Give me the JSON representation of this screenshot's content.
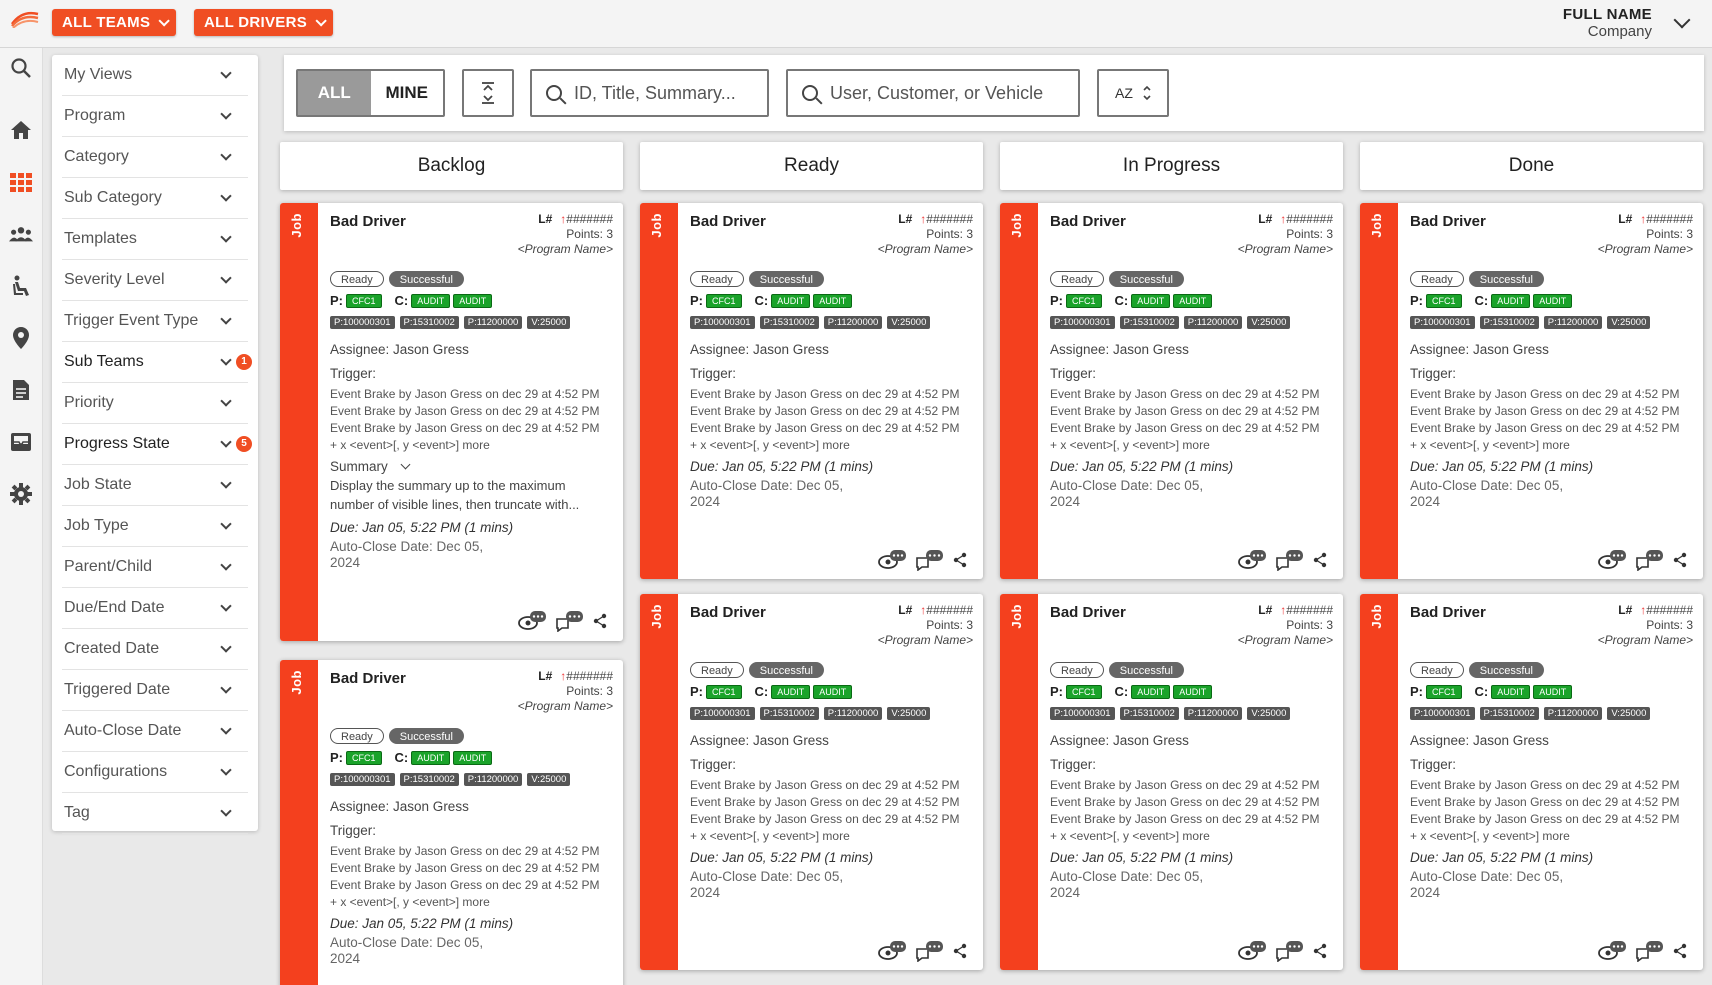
{
  "topbar": {
    "teams_label": "ALL TEAMS",
    "drivers_label": "ALL DRIVERS",
    "user_name": "FULL NAME",
    "user_company": "Company"
  },
  "rail": {
    "icons": [
      "search-icon",
      "home-icon",
      "grid-icon",
      "team-icon",
      "seat-icon",
      "location-pin-icon",
      "document-icon",
      "archive-icon",
      "gear-icon"
    ]
  },
  "filters": [
    {
      "label": "My Views",
      "badge": null
    },
    {
      "label": "Program",
      "badge": null
    },
    {
      "label": "Category",
      "badge": null
    },
    {
      "label": "Sub Category",
      "badge": null
    },
    {
      "label": "Templates",
      "badge": null
    },
    {
      "label": "Severity Level",
      "badge": null
    },
    {
      "label": "Trigger Event Type",
      "badge": null
    },
    {
      "label": "Sub Teams",
      "badge": "1"
    },
    {
      "label": "Priority",
      "badge": null
    },
    {
      "label": "Progress State",
      "badge": "5"
    },
    {
      "label": "Job State",
      "badge": null
    },
    {
      "label": "Job Type",
      "badge": null
    },
    {
      "label": "Parent/Child",
      "badge": null
    },
    {
      "label": "Due/End Date",
      "badge": null
    },
    {
      "label": "Created Date",
      "badge": null
    },
    {
      "label": "Triggered Date",
      "badge": null
    },
    {
      "label": "Auto-Close Date",
      "badge": null
    },
    {
      "label": "Configurations",
      "badge": null
    },
    {
      "label": "Tag",
      "badge": null
    }
  ],
  "toolbar": {
    "all_label": "ALL",
    "mine_label": "MINE",
    "search_placeholder": "ID, Title, Summary...",
    "user_search_placeholder": "User, Customer, or Vehicle",
    "sort_label": "AZ"
  },
  "columns": [
    "Backlog",
    "Ready",
    "In Progress",
    "Done"
  ],
  "card": {
    "tag": "Job",
    "title": "Bad Driver",
    "l_label": "L#",
    "arrow": "↑",
    "id_mask": "#######",
    "points": "Points: 3",
    "program": "<Program Name>",
    "chip_ready": "Ready",
    "chip_success": "Successful",
    "p_label": "P:",
    "p_tag": "CFC1",
    "c_label": "C:",
    "c_tags": [
      "AUDIT",
      "AUDIT"
    ],
    "ids": [
      "P:100000301",
      "P:15310002",
      "P:11200000",
      "V:25000"
    ],
    "assignee": "Assignee: Jason Gress",
    "trigger_label": "Trigger:",
    "events": [
      "Event Brake by Jason Gress on dec 29 at 4:52 PM",
      "Event Brake by Jason Gress on dec 29 at 4:52 PM",
      "Event Brake by Jason Gress on dec 29 at 4:52 PM"
    ],
    "more": "+ x <event>[, y <event>] more",
    "summary_label": "Summary",
    "summary_text": "Display the summary up to the maximum number of visible lines, then truncate with...",
    "due": "Due: Jan 05, 5:22 PM (1 mins)",
    "autoclose": "Auto-Close Date: Dec 05, 2024"
  },
  "colors": {
    "accent": "#f04e23",
    "stripe": "#f4401e",
    "green_tag": "#1aa32a"
  }
}
